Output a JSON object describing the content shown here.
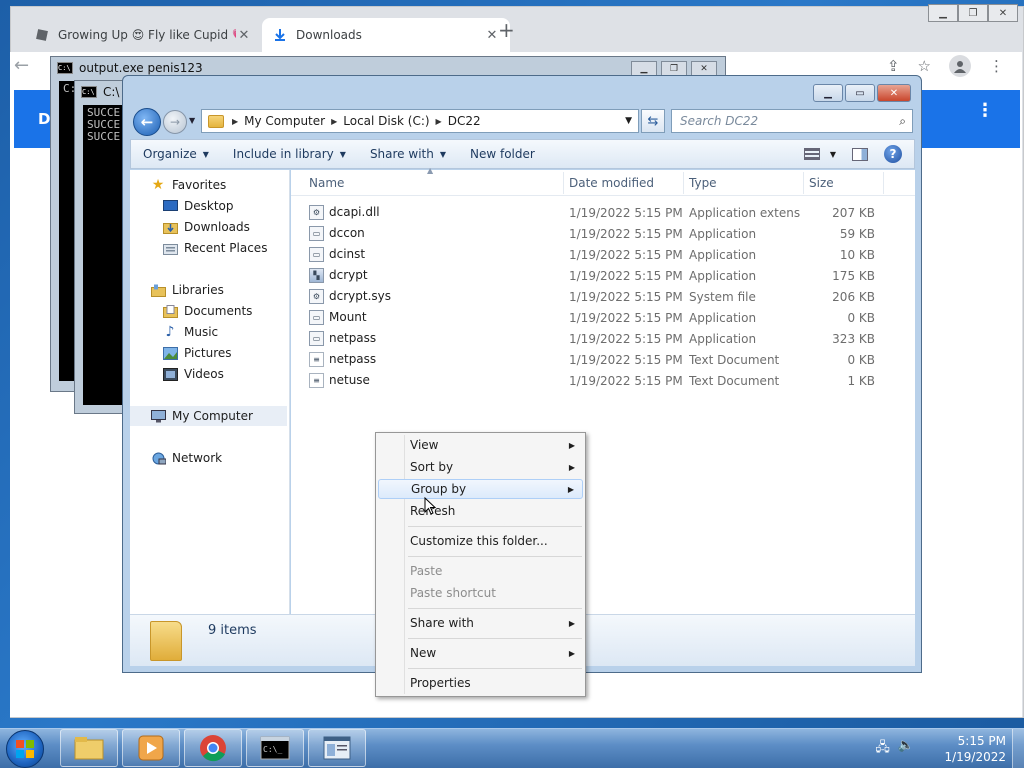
{
  "chrome": {
    "tabs": [
      {
        "label": "Growing Up 😍 Fly like Cupid 💗",
        "active": false
      },
      {
        "label": "Downloads",
        "active": true
      }
    ],
    "new_tab": "+",
    "close_glyph": "✕",
    "page_letter": "D"
  },
  "cmd1": {
    "title": "output.exe  penis123",
    "prompt": "C:"
  },
  "cmd2": {
    "title": "C:\\",
    "lines": [
      "SUCCE",
      "SUCCE",
      "SUCCE"
    ]
  },
  "explorer": {
    "breadcrumb": [
      "My Computer",
      "Local Disk (C:)",
      "DC22"
    ],
    "search_placeholder": "Search DC22",
    "toolbar": {
      "organize": "Organize",
      "include": "Include in library",
      "share": "Share with",
      "new_folder": "New folder"
    },
    "nav": {
      "favorites": "Favorites",
      "desktop": "Desktop",
      "downloads": "Downloads",
      "recent": "Recent Places",
      "libraries": "Libraries",
      "documents": "Documents",
      "music": "Music",
      "pictures": "Pictures",
      "videos": "Videos",
      "computer": "My Computer",
      "network": "Network"
    },
    "columns": {
      "name": "Name",
      "date": "Date modified",
      "type": "Type",
      "size": "Size"
    },
    "files": [
      {
        "name": "dcapi.dll",
        "date": "1/19/2022 5:15 PM",
        "type": "Application extens...",
        "size": "207 KB",
        "icon": "dll-icon"
      },
      {
        "name": "dccon",
        "date": "1/19/2022 5:15 PM",
        "type": "Application",
        "size": "59 KB",
        "icon": "app-icon"
      },
      {
        "name": "dcinst",
        "date": "1/19/2022 5:15 PM",
        "type": "Application",
        "size": "10 KB",
        "icon": "app-icon"
      },
      {
        "name": "dcrypt",
        "date": "1/19/2022 5:15 PM",
        "type": "Application",
        "size": "175 KB",
        "icon": "crypt-app-icon"
      },
      {
        "name": "dcrypt.sys",
        "date": "1/19/2022 5:15 PM",
        "type": "System file",
        "size": "206 KB",
        "icon": "sys-file-icon"
      },
      {
        "name": "Mount",
        "date": "1/19/2022 5:15 PM",
        "type": "Application",
        "size": "0 KB",
        "icon": "app-icon"
      },
      {
        "name": "netpass",
        "date": "1/19/2022 5:15 PM",
        "type": "Application",
        "size": "323 KB",
        "icon": "app-icon"
      },
      {
        "name": "netpass",
        "date": "1/19/2022 5:15 PM",
        "type": "Text Document",
        "size": "0 KB",
        "icon": "text-file-icon"
      },
      {
        "name": "netuse",
        "date": "1/19/2022 5:15 PM",
        "type": "Text Document",
        "size": "1 KB",
        "icon": "text-file-icon"
      }
    ],
    "status": "9 items"
  },
  "context_menu": {
    "view": "View",
    "sort_by": "Sort by",
    "group_by": "Group by",
    "refresh": "Refresh",
    "customize": "Customize this folder...",
    "paste": "Paste",
    "paste_shortcut": "Paste shortcut",
    "share_with": "Share with",
    "new": "New",
    "properties": "Properties"
  },
  "taskbar": {
    "time": "5:15 PM",
    "date": "1/19/2022"
  },
  "colors": {
    "chrome_blue": "#1a73e8",
    "menu_highlight": "#dceafb"
  }
}
